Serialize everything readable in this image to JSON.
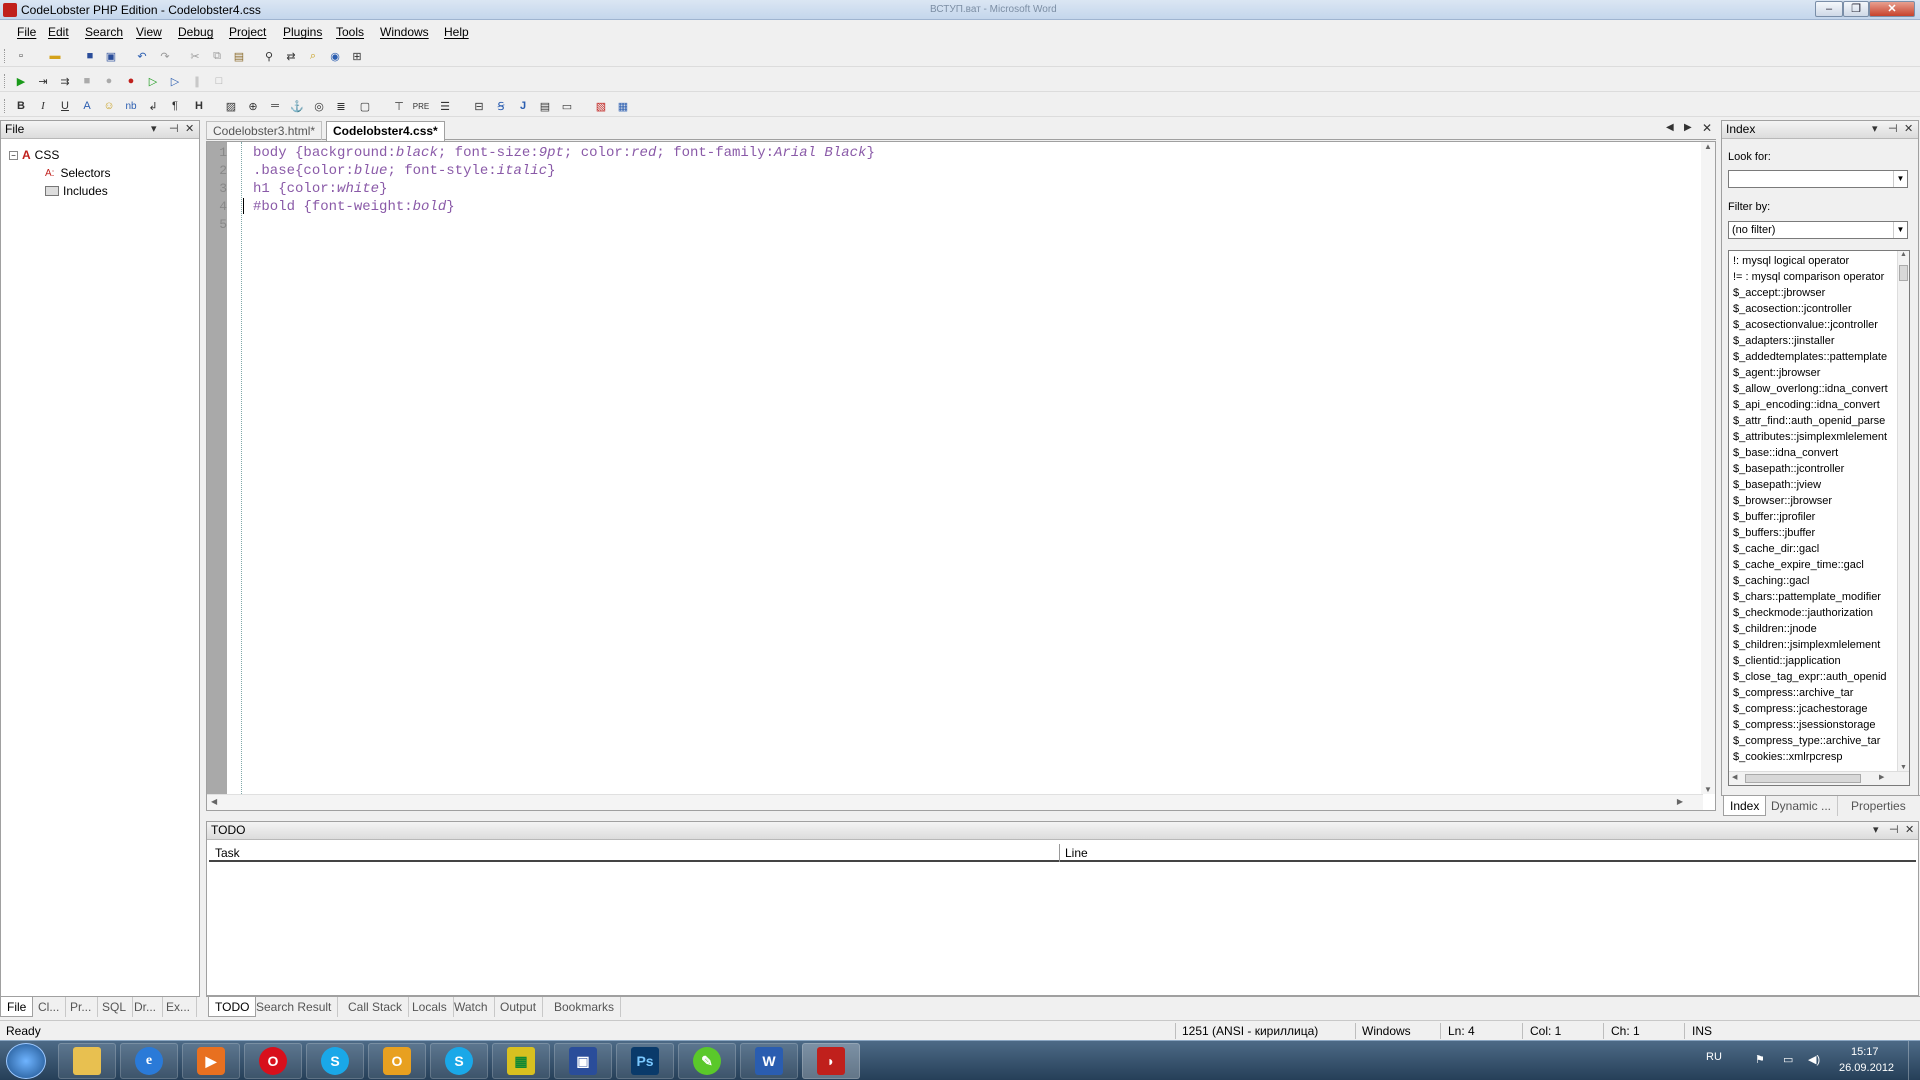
{
  "window": {
    "title": "CodeLobster PHP Edition - Codelobster4.css",
    "bg_title": "ВСТУП.ват - Microsoft Word"
  },
  "menu": [
    "File",
    "Edit",
    "Search",
    "View",
    "Debug",
    "Project",
    "Plugins",
    "Tools",
    "Windows",
    "Help"
  ],
  "left_panel": {
    "title": "File",
    "tree": {
      "root": "CSS",
      "children": [
        "Selectors",
        "Includes"
      ]
    },
    "tabs": [
      "File",
      "Cl...",
      "Pr...",
      "SQL",
      "Dr...",
      "Ex..."
    ]
  },
  "editor": {
    "tabs": [
      "Codelobster3.html*",
      "Codelobster4.css*"
    ],
    "active_tab": "Codelobster4.css*",
    "lines": [
      {
        "num": "1",
        "parts": [
          [
            "sel",
            "body "
          ],
          [
            "punc",
            "{"
          ],
          [
            "prop",
            "background"
          ],
          [
            "punc",
            ":"
          ],
          [
            "val",
            "black"
          ],
          [
            "punc",
            "; "
          ],
          [
            "prop",
            "font-size"
          ],
          [
            "punc",
            ":"
          ],
          [
            "val",
            "9pt"
          ],
          [
            "punc",
            "; "
          ],
          [
            "prop",
            "color"
          ],
          [
            "punc",
            ":"
          ],
          [
            "val",
            "red"
          ],
          [
            "punc",
            "; "
          ],
          [
            "prop",
            "font-family"
          ],
          [
            "punc",
            ":"
          ],
          [
            "val",
            "Arial Black"
          ],
          [
            "punc",
            "}"
          ]
        ]
      },
      {
        "num": "2",
        "parts": [
          [
            "sel",
            ".base"
          ],
          [
            "punc",
            "{"
          ],
          [
            "prop",
            "color"
          ],
          [
            "punc",
            ":"
          ],
          [
            "val",
            "blue"
          ],
          [
            "punc",
            "; "
          ],
          [
            "prop",
            "font-style"
          ],
          [
            "punc",
            ":"
          ],
          [
            "val",
            "italic"
          ],
          [
            "punc",
            "}"
          ]
        ]
      },
      {
        "num": "3",
        "parts": [
          [
            "sel",
            "h1 "
          ],
          [
            "punc",
            "{"
          ],
          [
            "prop",
            "color"
          ],
          [
            "punc",
            ":"
          ],
          [
            "val",
            "white"
          ],
          [
            "punc",
            "}"
          ]
        ]
      },
      {
        "num": "4",
        "parts": [
          [
            "sel",
            "#bold "
          ],
          [
            "punc",
            "{"
          ],
          [
            "prop",
            "font-weight"
          ],
          [
            "punc",
            ":"
          ],
          [
            "val",
            "bold"
          ],
          [
            "punc",
            "}"
          ]
        ]
      },
      {
        "num": "5",
        "parts": []
      }
    ]
  },
  "index_panel": {
    "title": "Index",
    "look_for_label": "Look for:",
    "look_for_value": "",
    "filter_label": "Filter by:",
    "filter_value": "(no filter)",
    "items": [
      "!: mysql logical operator",
      "!= : mysql comparison operator",
      "$_accept::jbrowser",
      "$_acosection::jcontroller",
      "$_acosectionvalue::jcontroller",
      "$_adapters::jinstaller",
      "$_addedtemplates::pattemplate",
      "$_agent::jbrowser",
      "$_allow_overlong::idna_convert",
      "$_api_encoding::idna_convert",
      "$_attr_find::auth_openid_parse",
      "$_attributes::jsimplexmlelement",
      "$_base::idna_convert",
      "$_basepath::jcontroller",
      "$_basepath::jview",
      "$_browser::jbrowser",
      "$_buffer::jprofiler",
      "$_buffers::jbuffer",
      "$_cache_dir::gacl",
      "$_cache_expire_time::gacl",
      "$_caching::gacl",
      "$_chars::pattemplate_modifier",
      "$_checkmode::jauthorization",
      "$_children::jnode",
      "$_children::jsimplexmlelement",
      "$_clientid::japplication",
      "$_close_tag_expr::auth_openid",
      "$_compress::archive_tar",
      "$_compress::jcachestorage",
      "$_compress::jsessionstorage",
      "$_compress_type::archive_tar",
      "$_cookies::xmlrpcresp"
    ],
    "tabs": [
      "Index",
      "Dynamic ...",
      "Properties"
    ]
  },
  "todo_panel": {
    "title": "TODO",
    "columns": [
      "Task",
      "Line"
    ],
    "tabs": [
      "TODO",
      "Search Result",
      "Call Stack",
      "Locals",
      "Watch",
      "Output",
      "Bookmarks"
    ]
  },
  "status": {
    "ready": "Ready",
    "encoding": "1251  (ANSI - кириллица)",
    "eol": "Windows",
    "ln": "Ln: 4",
    "col": "Col: 1",
    "ch": "Ch: 1",
    "mode": "INS"
  },
  "taskbar": {
    "lang": "RU",
    "time": "15:17",
    "date": "26.09.2012"
  }
}
